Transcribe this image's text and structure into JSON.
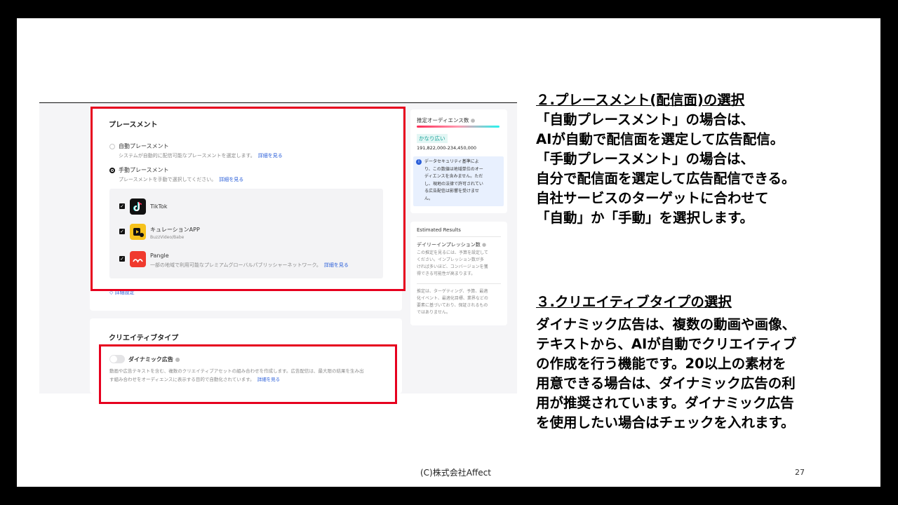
{
  "placement": {
    "title": "プレースメント",
    "auto_label": "自動プレースメント",
    "auto_desc": "システムが自動的に配信可能なプレースメントを選定します。",
    "details_link": "詳細を見る",
    "manual_label": "手動プレースメント",
    "manual_desc": "プレースメントを手動で選択してください。",
    "apps": [
      {
        "name": "TikTok",
        "sub": "",
        "icon": "tiktok-icon"
      },
      {
        "name": "キュレーションAPP",
        "sub": "BuzzVideo/Babe",
        "icon": "buzzvideo-icon"
      },
      {
        "name": "Pangle",
        "sub": "一部の地域で利用可能なプレミアムグローバルパブリッシャーネットワーク。",
        "icon": "pangle-icon"
      }
    ],
    "advanced": "詳細設定"
  },
  "creative": {
    "title": "クリエイティブタイプ",
    "dynamic_label": "ダイナミック広告",
    "dynamic_desc_line1": "動画や広告テキストを含む、複数のクリエイティブアセットの組み合わせを作成します。広告配信は、最大限の結果を生み出",
    "dynamic_desc_line2": "す組み合わせをオーディエンスに表示する目的で自動化されています。",
    "details_link": "詳細を見る"
  },
  "sidebar": {
    "audience_title": "推定オーディエンス数",
    "audience_badge": "かなり広い",
    "audience_range": "191,822,000-234,450,000",
    "notice_lines": [
      "データセキュリティ基準によ",
      "り、この数値は地域単位のオー",
      "ディエンスを含みません。ただ",
      "し、現地の法律で許可されてい",
      "る広告配信は影響を受けませ",
      "ん。"
    ],
    "estimated_title": "Estimated Results",
    "impressions_title": "デイリーインプレッション数",
    "impressions_lines": [
      "この推定を見るには、予算を設定して",
      "ください。インプレッション数が多",
      "ければ多いほど、コンバージョンを獲",
      "得できる可能性が高まります。"
    ],
    "disclaimer_lines": [
      "推定は、ターゲティング、予算、最適",
      "化イベント、最適化目標、業界などの",
      "要素に基づいており、保証されるもの",
      "ではありません。"
    ]
  },
  "explain": {
    "h2": "２.プレースメント(配信面)の選択",
    "p2": [
      "「自動プレースメント」の場合は、",
      "AIが自動で配信面を選定して広告配信。",
      "「手動プレースメント」の場合は、",
      "自分で配信面を選定して広告配信できる。",
      "自社サービスのターゲットに合わせて",
      "「自動」か「手動」を選択します。"
    ],
    "h3": "３.クリエイティブタイプの選択",
    "p3": [
      "ダイナミック広告は、複数の動画や画像、",
      "テキストから、AIが自動でクリエイティブ",
      "の作成を行う機能です。20以上の素材を",
      "用意できる場合は、ダイナミック広告の利",
      "用が推奨されています。ダイナミック広告",
      "を使用したい場合はチェックを入れます。"
    ]
  },
  "footer": {
    "copyright": "(C)株式会社Affect",
    "page": "27"
  },
  "colors": {
    "highlight": "#e6001e",
    "link": "#2b5fd9",
    "badge": "#1aa39a"
  }
}
